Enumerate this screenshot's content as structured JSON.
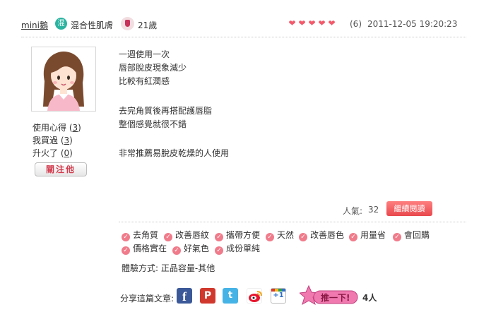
{
  "header": {
    "username": "mini鵝",
    "skin_badge": "混",
    "skin_type": "混合性肌膚",
    "age": "21歲",
    "hearts": [
      "❤",
      "❤",
      "❤",
      "❤",
      "❤"
    ],
    "rating_count": "(6)",
    "date": "2011-12-05 19:20:23"
  },
  "sidebar": {
    "avatar_icon": "girl-avatar",
    "stats": [
      {
        "label": "使用心得",
        "value": "3"
      },
      {
        "label": "我買過",
        "value": "3"
      },
      {
        "label": "升火了",
        "value": "0"
      }
    ],
    "follow_label": "關注他"
  },
  "review": {
    "lines": [
      "一週使用一次",
      "唇部脫皮現象減少",
      "比較有紅潤感",
      "",
      "去完角質後再搭配護唇脂",
      "整個感覺就很不錯",
      "",
      "非常推薦易脫皮乾燥的人使用"
    ]
  },
  "popularity": {
    "label": "人氣:",
    "value": "32",
    "read_more": "繼續閱讀"
  },
  "tags": [
    "去角質",
    "改善唇紋",
    "攜帶方便",
    "天然",
    "改善唇色",
    "用量省",
    "會回購",
    "價格實在",
    "好氣色",
    "成份單純"
  ],
  "experience": "體驗方式: 正品容量-其他",
  "share": {
    "label": "分享這篇文章:",
    "icons": [
      "facebook-icon",
      "plurk-icon",
      "twitter-icon",
      "weibo-icon",
      "google-plus-icon"
    ],
    "facebook_glyph": "f",
    "plurk_glyph": "P",
    "twitter_glyph": "t",
    "gplus_glyph": "+1",
    "push_label": "推一下!",
    "push_count": "4人"
  },
  "colors": {
    "accent_red": "#e8484e",
    "heart": "#f25a6b",
    "skin_badge": "#2bb3a0",
    "tag_check": "#f07b8a"
  }
}
